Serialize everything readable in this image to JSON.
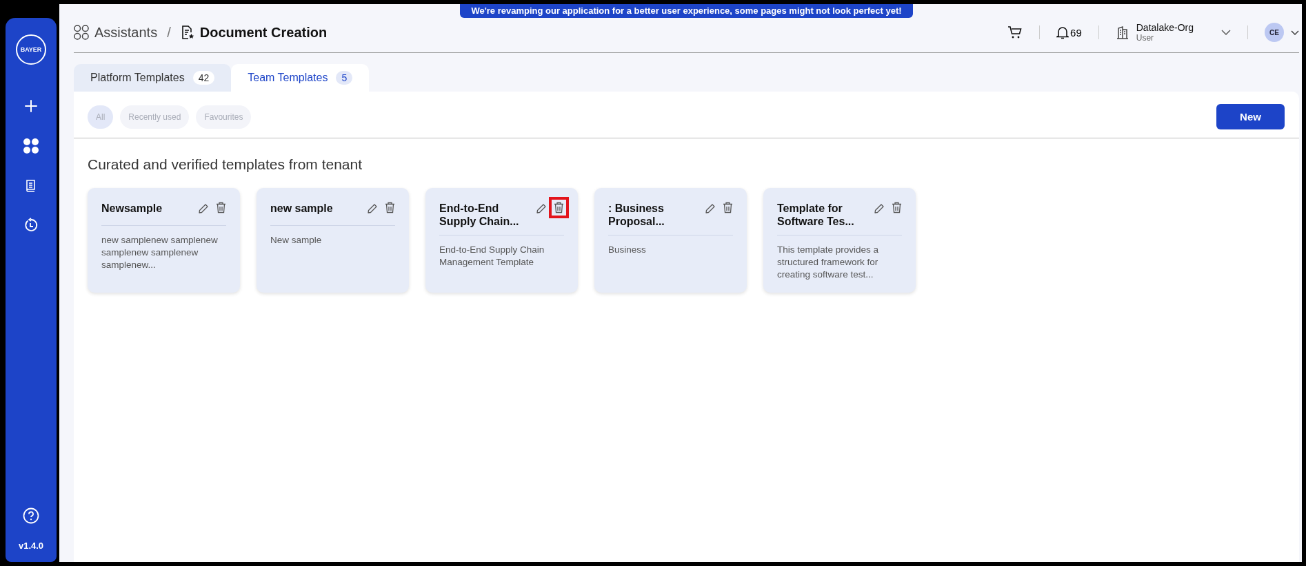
{
  "banner": "We're revamping our application for a better user experience, some pages might not look perfect yet!",
  "sidebar": {
    "logo": "BAYER",
    "version": "v1.4.0"
  },
  "breadcrumb": {
    "parent": "Assistants",
    "separator": "/",
    "current": "Document Creation"
  },
  "header": {
    "notifications": "69",
    "org": "Datalake-Org",
    "role": "User",
    "avatar": "CE"
  },
  "tabs": [
    {
      "label": "Platform Templates",
      "count": "42",
      "selected": false
    },
    {
      "label": "Team Templates",
      "count": "5",
      "selected": true
    }
  ],
  "filters": [
    {
      "label": "All",
      "selected": true
    },
    {
      "label": "Recently used",
      "selected": false
    },
    {
      "label": "Favourites",
      "selected": false
    }
  ],
  "new_button": "New",
  "heading": "Curated and verified templates from tenant",
  "cards": [
    {
      "title": "Newsample",
      "description": "new samplenew samplenew samplenew samplenew samplenew...",
      "delete_highlighted": false
    },
    {
      "title": "new sample",
      "description": "New sample",
      "delete_highlighted": false
    },
    {
      "title": "End-to-End Supply Chain...",
      "description": "End-to-End Supply Chain Management Template",
      "delete_highlighted": true
    },
    {
      "title": ": Business Proposal...",
      "description": "Business",
      "delete_highlighted": false
    },
    {
      "title": "Template for Software Tes...",
      "description": "This template provides a structured framework for creating software test...",
      "delete_highlighted": false
    }
  ]
}
